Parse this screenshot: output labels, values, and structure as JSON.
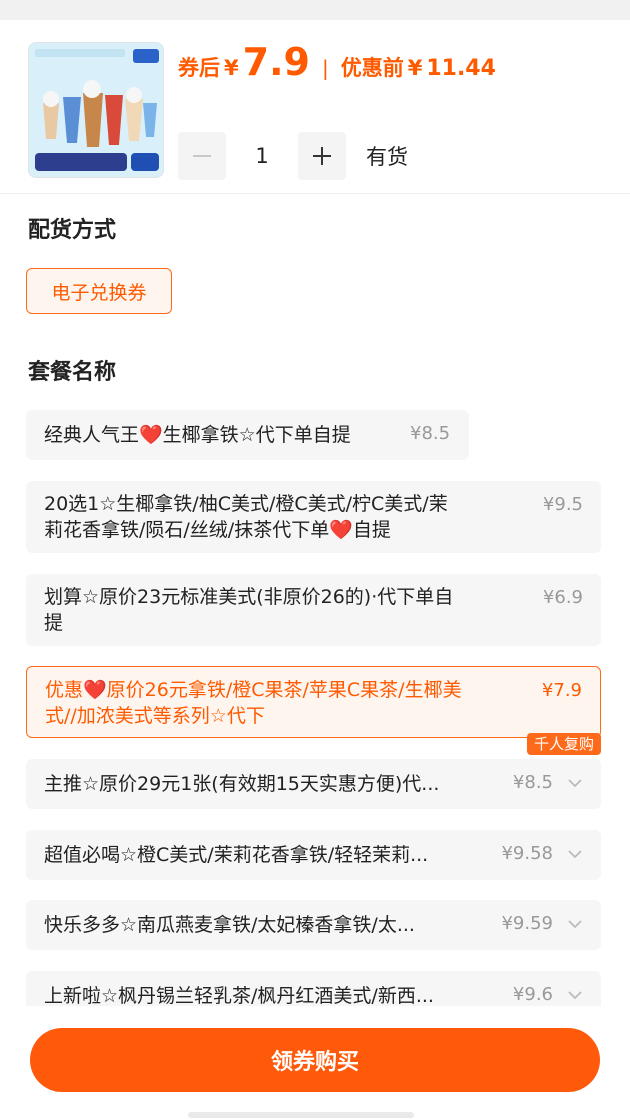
{
  "header": {
    "coupon_label": "券后",
    "currency": "¥",
    "coupon_price": "7.9",
    "separator": "|",
    "original_label": "优惠前",
    "original_price": "11.44",
    "quantity": "1",
    "stock_status": "有货",
    "thumbnail": {
      "banner_text": "瑞•经典必喝20选1",
      "brand_text": "全国通用"
    }
  },
  "delivery": {
    "title": "配货方式",
    "option": "电子兑换券"
  },
  "package": {
    "title": "套餐名称",
    "options": [
      {
        "text": "经典人气王❤️生椰拿铁☆代下单自提",
        "price": "¥8.5"
      },
      {
        "text_line1": "20选1☆生椰拿铁/柚C美式/橙C美式/柠C美式/茉",
        "text_line2": "莉花香拿铁/陨石/丝绒/抹茶代下单❤️自提",
        "price": "¥9.5"
      },
      {
        "text_line1": "划算☆原价23元标准美式(非原价26的)·代下单自",
        "text_line2": "提",
        "price": "¥6.9"
      },
      {
        "text_line1": "优惠❤️原价26元拿铁/橙C果茶/苹果C果茶/生椰美",
        "text_line2": "式//加浓美式等系列☆代下",
        "price": "¥7.9",
        "selected": true
      },
      {
        "text": "主推☆原价29元1张(有效期15天实惠方便)代...",
        "price": "¥8.5",
        "badge": "千人复购"
      },
      {
        "text": "超值必喝☆橙C美式/茉莉花香拿铁/轻轻茉莉...",
        "price": "¥9.58"
      },
      {
        "text": "快乐多多☆南瓜燕麦拿铁/太妃榛香拿铁/太...",
        "price": "¥9.59"
      },
      {
        "text": "上新啦☆枫丹锡兰轻乳茶/枫丹红酒美式/新西...",
        "price": "¥9.6"
      }
    ]
  },
  "footer": {
    "buy_label": "领券购买"
  },
  "colors": {
    "accent": "#ff5a00",
    "selected_bg": "#fff5ef",
    "option_bg": "#f6f6f6"
  }
}
